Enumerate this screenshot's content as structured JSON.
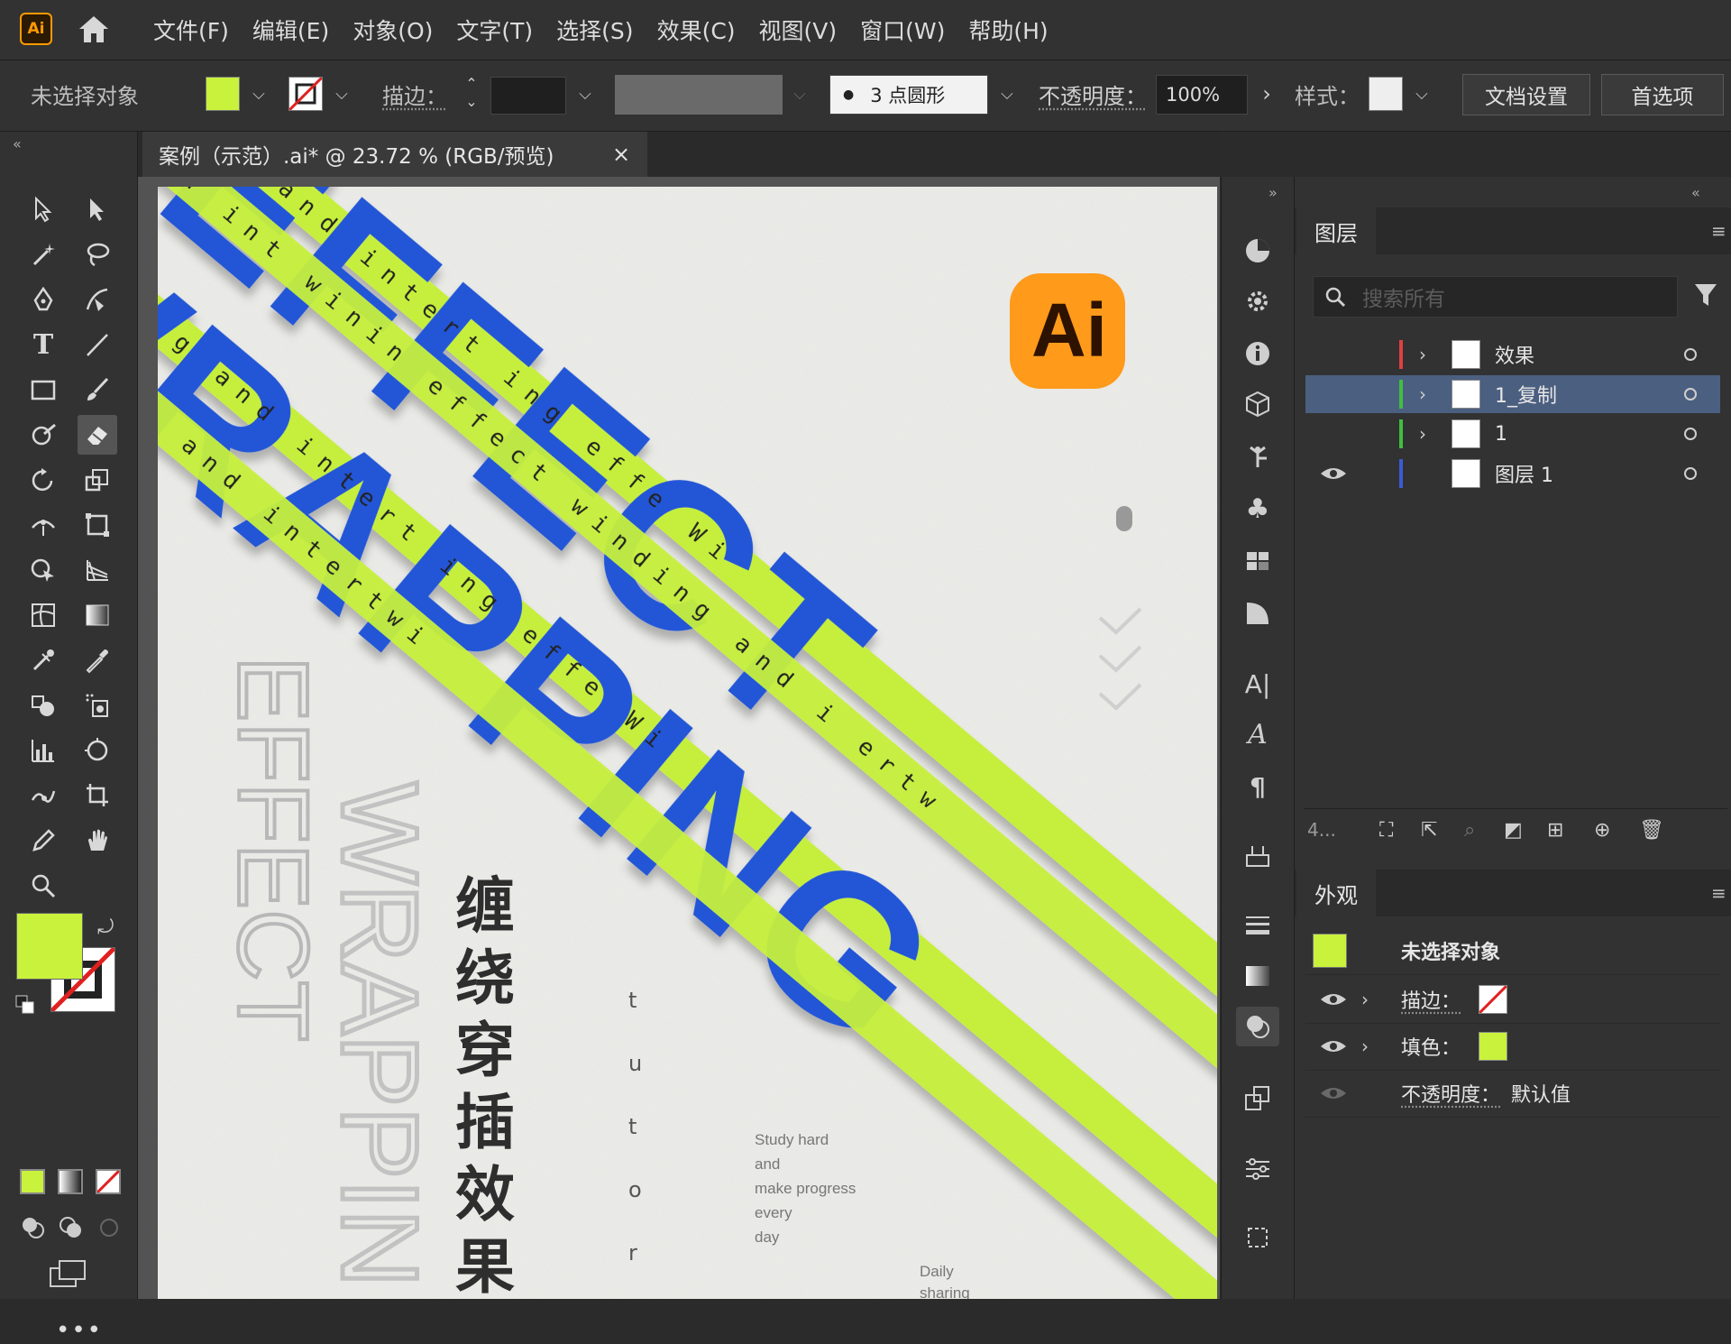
{
  "app": {
    "logo": "Ai"
  },
  "menu": [
    "文件(F)",
    "编辑(E)",
    "对象(O)",
    "文字(T)",
    "选择(S)",
    "效果(C)",
    "视图(V)",
    "窗口(W)",
    "帮助(H)"
  ],
  "control": {
    "selection": "未选择对象",
    "fill_color": "#c8f23c",
    "stroke_label": "描边：",
    "brush_value": "3 点圆形",
    "opacity_label": "不透明度：",
    "opacity_value": "100%",
    "style_label": "样式：",
    "doc_setup": "文档设置",
    "prefs": "首选项"
  },
  "document": {
    "tab_title": "案例（示范）.ai* @ 23.72 % (RGB/预览)",
    "close": "×"
  },
  "artwork": {
    "headline_1": "EFFECT",
    "headline_2": "WRAPPING",
    "ribbon_1": "Win g and intert  ing effe  Wi",
    "ribbon_2": "and int winin  effect  winding and i  ertw",
    "ribbon_3": "ing and intertwi",
    "side_title_1": "EFFECT",
    "side_title_2": "WRAPPIN",
    "chinese_title": [
      "缠",
      "绕",
      "穿",
      "插",
      "效",
      "果"
    ],
    "vertical_text": [
      "t",
      "u",
      "t",
      "o",
      "r"
    ],
    "tagline": [
      "Study hard",
      "and",
      "make progress",
      "every",
      "day"
    ],
    "footer": [
      "Daily",
      "sharing"
    ],
    "badge": "Ai",
    "blue": "#2456d6",
    "lime": "#c6ef3c"
  },
  "layers_panel": {
    "tab": "图层",
    "search_placeholder": "搜索所有",
    "layers": [
      {
        "name": "效果",
        "color": "#e04040",
        "visible": false,
        "selected": false
      },
      {
        "name": "1_复制",
        "color": "#3fbf3f",
        "visible": false,
        "selected": true
      },
      {
        "name": "1",
        "color": "#3fbf3f",
        "visible": false,
        "selected": false
      },
      {
        "name": "图层 1",
        "color": "#3b5bd6",
        "visible": true,
        "selected": false
      }
    ],
    "footer_count": "4..."
  },
  "appearance_panel": {
    "tab": "外观",
    "title": "未选择对象",
    "stroke_label": "描边：",
    "fill_label": "填色：",
    "opacity_label": "不透明度：",
    "opacity_value": "默认值"
  }
}
